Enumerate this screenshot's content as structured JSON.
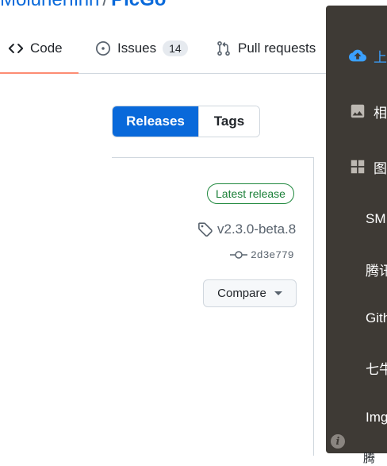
{
  "breadcrumb": {
    "owner": "Molunerfinn",
    "separator": "/",
    "repo": "PicGo"
  },
  "tabs": {
    "code": {
      "label": "Code",
      "icon": "code-icon"
    },
    "issues": {
      "label": "Issues",
      "count": "14",
      "icon": "issue-opened-icon"
    },
    "pull_requests": {
      "label": "Pull requests",
      "icon": "git-pull-request-icon"
    }
  },
  "releases_toggle": {
    "releases_label": "Releases",
    "tags_label": "Tags"
  },
  "release": {
    "badge": "Latest release",
    "tag": "v2.3.0-beta.8",
    "commit": "2d3e779",
    "compare_label": "Compare"
  },
  "dropdown_menu": {
    "items": [
      {
        "label": "上",
        "icon": "cloud-upload-icon",
        "active": true
      },
      {
        "label": "相",
        "icon": "image-icon"
      },
      {
        "label": "图",
        "icon": "grid-icon"
      },
      {
        "label": "SM"
      },
      {
        "label": "腾讯"
      },
      {
        "label": "Gith"
      },
      {
        "label": "七牛"
      },
      {
        "label": "Img"
      }
    ],
    "info_icon": "info-icon"
  },
  "bottom_peek_text": "腾"
}
